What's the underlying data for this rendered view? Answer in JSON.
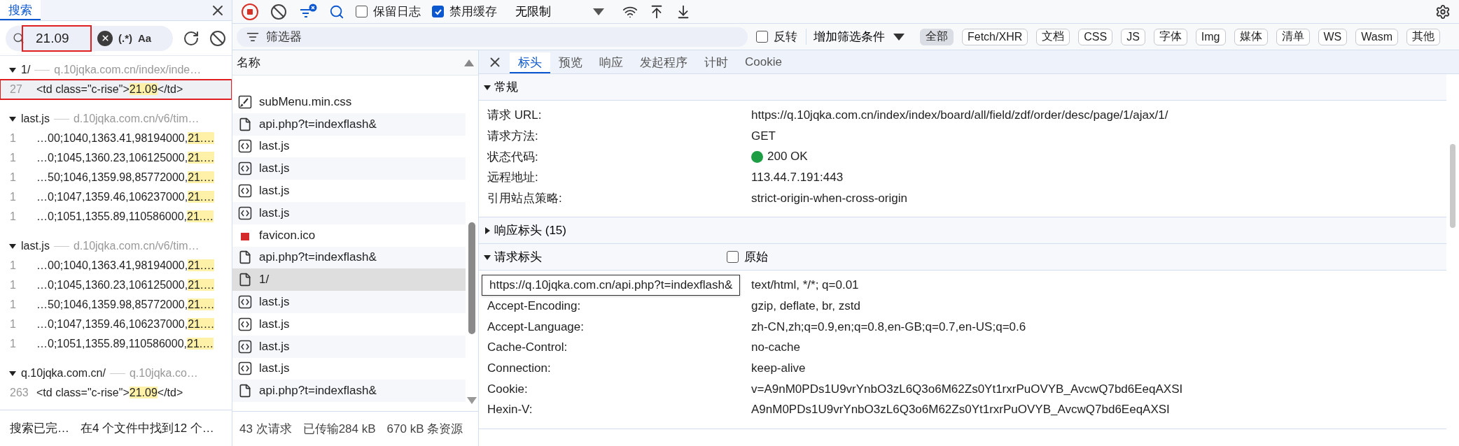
{
  "search_panel": {
    "tab": {
      "label": "搜索",
      "selected": true
    },
    "query": "21.09",
    "query_marked": true,
    "regex_label": "(.*)",
    "case_label": "Aa",
    "groups": [
      {
        "file": "1/",
        "url": "q.10jqka.com.cn/index/inde…",
        "matches": [
          {
            "line": "27",
            "before": "<td class=\"c-rise\">",
            "match": "21.09",
            "after": "</td>",
            "selected": true,
            "marked": true
          }
        ]
      },
      {
        "file": "last.js",
        "url": "d.10jqka.com.cn/v6/tim…",
        "matches": [
          {
            "line": "1",
            "before": "…00;1040,1363.41,98194000,",
            "match": "21.…",
            "selected": false,
            "marked": false
          },
          {
            "line": "1",
            "before": "…0;1045,1360.23,106125000,",
            "match": "21.…",
            "selected": false,
            "marked": false
          },
          {
            "line": "1",
            "before": "…50;1046,1359.98,85772000,",
            "match": "21.…",
            "selected": false,
            "marked": false
          },
          {
            "line": "1",
            "before": "…0;1047,1359.46,106237000,",
            "match": "21.…",
            "selected": false,
            "marked": false
          },
          {
            "line": "1",
            "before": "…0;1051,1355.89,110586000,",
            "match": "21.…",
            "selected": false,
            "marked": false
          }
        ]
      },
      {
        "file": "last.js",
        "url": "d.10jqka.com.cn/v6/tim…",
        "matches": [
          {
            "line": "1",
            "before": "…00;1040,1363.41,98194000,",
            "match": "21.…",
            "selected": false,
            "marked": false
          },
          {
            "line": "1",
            "before": "…0;1045,1360.23,106125000,",
            "match": "21.…",
            "selected": false,
            "marked": false
          },
          {
            "line": "1",
            "before": "…50;1046,1359.98,85772000,",
            "match": "21.…",
            "selected": false,
            "marked": false
          },
          {
            "line": "1",
            "before": "…0;1047,1359.46,106237000,",
            "match": "21.…",
            "selected": false,
            "marked": false
          },
          {
            "line": "1",
            "before": "…0;1051,1355.89,110586000,",
            "match": "21.…",
            "selected": false,
            "marked": false
          }
        ]
      },
      {
        "file": "q.10jqka.com.cn/",
        "url": "q.10jqka.co…",
        "matches": [
          {
            "line": "263",
            "before": "<td class=\"c-rise\">",
            "match": "21.09",
            "after": "</td>",
            "selected": false,
            "marked": false
          }
        ]
      }
    ],
    "status": "搜索已完…",
    "summary": "在4 个文件中找到12 个…"
  },
  "toolbar": {
    "recording": true,
    "preserve_log": {
      "label": "保留日志",
      "checked": false
    },
    "disable_cache": {
      "label": "禁用缓存",
      "checked": true
    },
    "throttling": "无限制"
  },
  "filter_bar": {
    "placeholder": "筛选器",
    "invert": {
      "label": "反转",
      "checked": false
    },
    "more_filters": "增加筛选条件",
    "types": [
      {
        "label": "全部",
        "selected": true
      },
      {
        "label": "Fetch/XHR",
        "selected": false
      },
      {
        "label": "文档",
        "selected": false
      },
      {
        "label": "CSS",
        "selected": false
      },
      {
        "label": "JS",
        "selected": false
      },
      {
        "label": "字体",
        "selected": false
      },
      {
        "label": "Img",
        "selected": false
      },
      {
        "label": "媒体",
        "selected": false
      },
      {
        "label": "清单",
        "selected": false
      },
      {
        "label": "WS",
        "selected": false
      },
      {
        "label": "Wasm",
        "selected": false
      },
      {
        "label": "其他",
        "selected": false
      }
    ]
  },
  "requests": {
    "column": "名称",
    "rows": [
      {
        "kind": "stylesheet",
        "name": "subMenu.min.css",
        "selected": false
      },
      {
        "kind": "document",
        "name": "api.php?t=indexflash&",
        "selected": false
      },
      {
        "kind": "script",
        "name": "last.js",
        "selected": false
      },
      {
        "kind": "script",
        "name": "last.js",
        "selected": false
      },
      {
        "kind": "script",
        "name": "last.js",
        "selected": false
      },
      {
        "kind": "script",
        "name": "last.js",
        "selected": false
      },
      {
        "kind": "image",
        "name": "favicon.ico",
        "selected": false
      },
      {
        "kind": "document",
        "name": "api.php?t=indexflash&",
        "selected": false
      },
      {
        "kind": "document",
        "name": "1/",
        "selected": true
      },
      {
        "kind": "script",
        "name": "last.js",
        "selected": false
      },
      {
        "kind": "script",
        "name": "last.js",
        "selected": false
      },
      {
        "kind": "script",
        "name": "last.js",
        "selected": false
      },
      {
        "kind": "script",
        "name": "last.js",
        "selected": false
      },
      {
        "kind": "document",
        "name": "api.php?t=indexflash&",
        "selected": false
      }
    ],
    "summary": [
      "43 次请求",
      "已传输284 kB",
      "670 kB 条资源"
    ]
  },
  "tooltip": "https://q.10jqka.com.cn/api.php?t=indexflash&",
  "details": {
    "tabs": [
      {
        "label": "标头",
        "selected": true
      },
      {
        "label": "预览",
        "selected": false
      },
      {
        "label": "响应",
        "selected": false
      },
      {
        "label": "发起程序",
        "selected": false
      },
      {
        "label": "计时",
        "selected": false
      },
      {
        "label": "Cookie",
        "selected": false
      }
    ],
    "sections": [
      {
        "title": "常规",
        "expanded": true,
        "rows": [
          {
            "name": "请求 URL:",
            "value": "https://q.10jqka.com.cn/index/index/board/all/field/zdf/order/desc/page/1/ajax/1/"
          },
          {
            "name": "请求方法:",
            "value": "GET"
          },
          {
            "name": "状态代码:",
            "value": "200 OK",
            "color": "#1e9e44"
          },
          {
            "name": "远程地址:",
            "value": "113.44.7.191:443"
          },
          {
            "name": "引用站点策略:",
            "value": "strict-origin-when-cross-origin"
          }
        ]
      },
      {
        "title": "响应标头 (15)",
        "expanded": false
      },
      {
        "title": "请求标头",
        "expanded": true,
        "raw": {
          "label": "原始",
          "checked": false
        },
        "rows": [
          {
            "value": "text/html, */*; q=0.01"
          },
          {
            "name": "Accept-Encoding:",
            "value": "gzip, deflate, br, zstd"
          },
          {
            "name": "Accept-Language:",
            "value": "zh-CN,zh;q=0.9,en;q=0.8,en-GB;q=0.7,en-US;q=0.6"
          },
          {
            "name": "Cache-Control:",
            "value": "no-cache"
          },
          {
            "name": "Connection:",
            "value": "keep-alive"
          },
          {
            "name": "Cookie:",
            "value": "v=A9nM0PDs1U9vrYnbO3zL6Q3o6M62Zs0Yt1rxrPuOVYB_AvcwQ7bd6EeqAXSI"
          },
          {
            "name": "Hexin-V:",
            "value": "A9nM0PDs1U9vrYnbO3zL6Q3o6M62Zs0Yt1rxrPuOVYB_AvcwQ7bd6EeqAXSI"
          }
        ]
      }
    ]
  }
}
